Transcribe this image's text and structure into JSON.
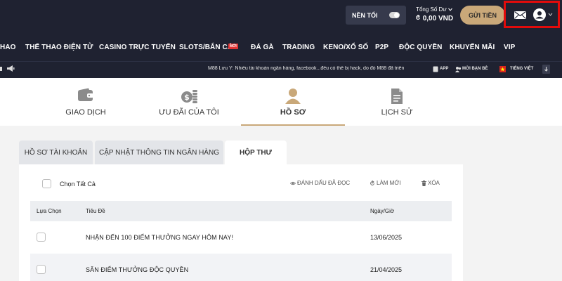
{
  "header": {
    "mode_toggle_label": "NỀN TỐI",
    "balance_label": "Tổng Số Dư",
    "balance_value": "0,00 VND",
    "deposit_button": "GỬI TIỀN"
  },
  "nav": {
    "items": [
      "HAO",
      "THỂ THAO ĐIỆN TỬ",
      "CASINO TRỰC TUYẾN",
      "SLOTS/BẮN CÁ",
      "ĐÁ GÀ",
      "TRADING",
      "KENO/XỔ SỐ",
      "P2P",
      "ĐỘC QUYỀN",
      "KHUYẾN MÃI",
      "VIP"
    ],
    "new_badge": "MỚI"
  },
  "ticker": {
    "message": "M88 Lưu Ý: Nhiều tài khoản ngân hàng, facebook...đều có thể bị hack, do đó M88 đã triển",
    "app_label": "APP",
    "invite_label": "MỜI BẠN BÈ",
    "language_label": "TIẾNG VIỆT"
  },
  "profile_tabs": [
    {
      "label": "GIAO DỊCH",
      "icon": "wallet-icon"
    },
    {
      "label": "ƯU ĐÃI CỦA TÔI",
      "icon": "coins-icon"
    },
    {
      "label": "HỒ SƠ",
      "icon": "user-profile-icon"
    },
    {
      "label": "LỊCH SỬ",
      "icon": "document-icon"
    }
  ],
  "sub_tabs": [
    "HỒ SƠ TÀI KHOẢN",
    "CẬP NHẬT THÔNG TIN NGÂN HÀNG",
    "HỘP THƯ"
  ],
  "inbox": {
    "select_all": "Chọn Tất Cả",
    "mark_read": "ĐÁNH DẤU ĐÃ ĐỌC",
    "refresh": "LÀM MỚI",
    "delete": "XÓA",
    "columns": {
      "select": "Lựa Chọn",
      "title": "Tiêu Đề",
      "date": "Ngày/Giờ"
    },
    "rows": [
      {
        "title": "NHẬN ĐẾN 100 ĐIỂM THƯỞNG NGAY HÔM NAY!",
        "date": "13/06/2025"
      },
      {
        "title": "SĂN ĐIỂM THƯỞNG ĐỘC QUYỀN",
        "date": "21/04/2025"
      }
    ]
  },
  "colors": {
    "dark_bg": "#1f2231",
    "accent_gold": "#c9a879",
    "highlight_red": "#e20b0b"
  }
}
